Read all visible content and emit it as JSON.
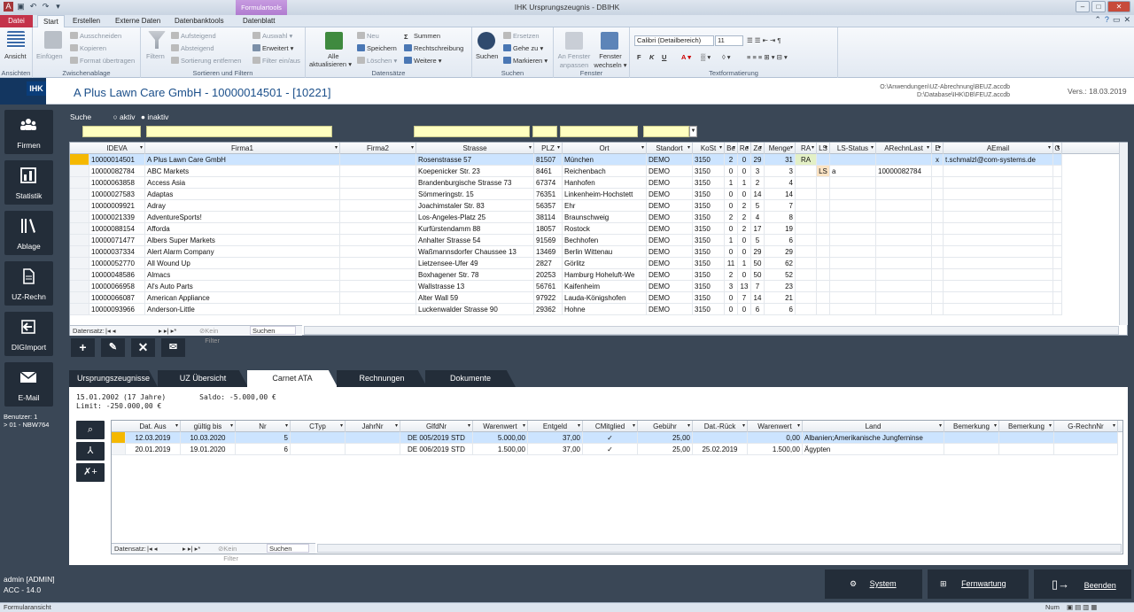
{
  "titlebar": {
    "title": "IHK Ursprungszeugnis - DBIHK",
    "context_tab_group": "Formulartools"
  },
  "ribbon_tabs": [
    {
      "label": "Datei"
    },
    {
      "label": "Start"
    },
    {
      "label": "Erstellen"
    },
    {
      "label": "Externe Daten"
    },
    {
      "label": "Datenbanktools"
    },
    {
      "label": "Datenblatt"
    }
  ],
  "ribbon": {
    "ansichten": {
      "label": "Ansichten",
      "ansicht": "Ansicht"
    },
    "zwischenablage": {
      "label": "Zwischenablage",
      "einfuegen": "Einfügen",
      "ausschneiden": "Ausschneiden",
      "kopieren": "Kopieren",
      "format": "Format übertragen"
    },
    "sortieren": {
      "label": "Sortieren und Filtern",
      "filter": "Filtern",
      "aufsteigend": "Aufsteigend",
      "absteigend": "Absteigend",
      "sortierung": "Sortierung entfernen",
      "auswahl": "Auswahl",
      "erweitert": "Erweitert",
      "filter_ein": "Filter ein/aus"
    },
    "datensaetze": {
      "label": "Datensätze",
      "alle": "Alle",
      "aktualisieren": "aktualisieren",
      "neu": "Neu",
      "speichern": "Speichern",
      "loeschen": "Löschen",
      "summen": "Summen",
      "rechtschreibung": "Rechtschreibung",
      "weitere": "Weitere"
    },
    "suchen": {
      "label": "Suchen",
      "suchen": "Suchen",
      "ersetzen": "Ersetzen",
      "gehe": "Gehe zu",
      "markieren": "Markieren"
    },
    "fenster": {
      "label": "Fenster",
      "anpassen1": "An Fenster",
      "anpassen2": "anpassen",
      "wechseln1": "Fenster",
      "wechseln2": "wechseln"
    },
    "text": {
      "label": "Textformatierung",
      "font": "Calibri (Detailbereich)",
      "size": "11"
    }
  },
  "header": {
    "record_title": "A Plus Lawn Care GmbH - 10000014501 - [10221]",
    "path1": "O:\\Anwendungen\\UZ-Abrechnung\\BEUZ.accdb",
    "path2": "D:\\Database\\IHK\\DB\\FEUZ.accdb",
    "version": "Vers.: 18.03.2019",
    "logo_text": "IHK"
  },
  "leftnav": [
    {
      "label": "Firmen",
      "icon": "people-icon"
    },
    {
      "label": "Statistik",
      "icon": "chart-icon"
    },
    {
      "label": "Ablage",
      "icon": "books-icon"
    },
    {
      "label": "UZ-Rechn",
      "icon": "document-icon"
    },
    {
      "label": "DIGImport",
      "icon": "import-icon"
    },
    {
      "label": "E-Mail",
      "icon": "mail-icon"
    }
  ],
  "benutzer": {
    "line1": "Benutzer: 1",
    "line2": "> 01 - NBW764"
  },
  "search": {
    "label": "Suche",
    "aktiv": "aktiv",
    "inaktiv": "inaktiv"
  },
  "companies": {
    "columns": [
      "IDEVA",
      "Firma1",
      "Firma2",
      "Strasse",
      "PLZ",
      "Ort",
      "Standort",
      "KoSt",
      "Be",
      "Re",
      "Ze",
      "Menge",
      "RA",
      "LS",
      "LS-Status",
      "ARechnLast",
      "E",
      "AEmail",
      "G"
    ],
    "rows": [
      [
        "10000014501",
        "A Plus Lawn Care GmbH",
        "",
        "Rosenstrasse 57",
        "81507",
        "München",
        "DEMO",
        "3150",
        "2",
        "0",
        "29",
        "31",
        "RA",
        "",
        "",
        "",
        "x",
        "t.schmalzl@com-systems.de",
        ""
      ],
      [
        "10000082784",
        "ABC Markets",
        "",
        "Koepenicker Str. 23",
        "8461",
        "Reichenbach",
        "DEMO",
        "3150",
        "0",
        "0",
        "3",
        "3",
        "",
        "LS",
        "a",
        "10000082784",
        "",
        "",
        ""
      ],
      [
        "10000063858",
        "Access Asia",
        "",
        "Brandenburgische Strasse 73",
        "67374",
        "Hanhofen",
        "DEMO",
        "3150",
        "1",
        "1",
        "2",
        "4",
        "",
        "",
        "",
        "",
        "",
        "",
        ""
      ],
      [
        "10000027583",
        "Adaptas",
        "",
        "Sömmeringstr. 15",
        "76351",
        "Linkenheim-Hochstett",
        "DEMO",
        "3150",
        "0",
        "0",
        "14",
        "14",
        "",
        "",
        "",
        "",
        "",
        "",
        ""
      ],
      [
        "10000009921",
        "Adray",
        "",
        "Joachimstaler Str. 83",
        "56357",
        "Ehr",
        "DEMO",
        "3150",
        "0",
        "2",
        "5",
        "7",
        "",
        "",
        "",
        "",
        "",
        "",
        ""
      ],
      [
        "10000021339",
        "AdventureSports!",
        "",
        "Los-Angeles-Platz 25",
        "38114",
        "Braunschweig",
        "DEMO",
        "3150",
        "2",
        "2",
        "4",
        "8",
        "",
        "",
        "",
        "",
        "",
        "",
        ""
      ],
      [
        "10000088154",
        "Afforda",
        "",
        "Kurfürstendamm 88",
        "18057",
        "Rostock",
        "DEMO",
        "3150",
        "0",
        "2",
        "17",
        "19",
        "",
        "",
        "",
        "",
        "",
        "",
        ""
      ],
      [
        "10000071477",
        "Albers Super Markets",
        "",
        "Anhalter Strasse 54",
        "91569",
        "Bechhofen",
        "DEMO",
        "3150",
        "1",
        "0",
        "5",
        "6",
        "",
        "",
        "",
        "",
        "",
        "",
        ""
      ],
      [
        "10000037334",
        "Alert Alarm Company",
        "",
        "Waßmannsdorfer Chaussee 13",
        "13469",
        "Berlin Wittenau",
        "DEMO",
        "3150",
        "0",
        "0",
        "29",
        "29",
        "",
        "",
        "",
        "",
        "",
        "",
        ""
      ],
      [
        "10000052770",
        "All Wound Up",
        "",
        "Lietzensee-Ufer 49",
        "2827",
        "Görlitz",
        "DEMO",
        "3150",
        "11",
        "1",
        "50",
        "62",
        "",
        "",
        "",
        "",
        "",
        "",
        ""
      ],
      [
        "10000048586",
        "Almacs",
        "",
        "Boxhagener Str. 78",
        "20253",
        "Hamburg Hoheluft-We",
        "DEMO",
        "3150",
        "2",
        "0",
        "50",
        "52",
        "",
        "",
        "",
        "",
        "",
        "",
        ""
      ],
      [
        "10000066958",
        "Al's Auto Parts",
        "",
        "Wallstrasse 13",
        "56761",
        "Kaifenheim",
        "DEMO",
        "3150",
        "3",
        "13",
        "7",
        "23",
        "",
        "",
        "",
        "",
        "",
        "",
        ""
      ],
      [
        "10000066087",
        "American Appliance",
        "",
        "Alter Wall 59",
        "97922",
        "Lauda-Königshofen",
        "DEMO",
        "3150",
        "0",
        "7",
        "14",
        "21",
        "",
        "",
        "",
        "",
        "",
        "",
        ""
      ],
      [
        "10000093966",
        "Anderson-Little",
        "",
        "Luckenwalder Strasse 90",
        "29362",
        "Hohne",
        "DEMO",
        "3150",
        "0",
        "0",
        "6",
        "6",
        "",
        "",
        "",
        "",
        "",
        "",
        ""
      ]
    ],
    "navbar": {
      "label": "Datensatz:",
      "kein_filter": "Kein Filter",
      "suchen": "Suchen"
    }
  },
  "tabs": [
    {
      "label": "Ursprungszeugnisse"
    },
    {
      "label": "UZ Übersicht"
    },
    {
      "label": "Carnet ATA"
    },
    {
      "label": "Rechnungen"
    },
    {
      "label": "Dokumente"
    }
  ],
  "carnet_info": {
    "line1": "15.01.2002 (17 Jahre)",
    "saldo": "Saldo: -5.000,00 €",
    "line2": "Limit: -250.000,00 €"
  },
  "carnet": {
    "columns": [
      "Dat. Aus",
      "gültig bis",
      "Nr",
      "CTyp",
      "JahrNr",
      "GlfdNr",
      "Warenwert",
      "Entgeld",
      "CMitglied",
      "Gebühr",
      "Dat.-Rück",
      "Warenwert",
      "Land",
      "Bemerkung",
      "Bemerkung",
      "G-RechnNr"
    ],
    "rows": [
      [
        "12.03.2019",
        "10.03.2020",
        "5",
        "",
        "",
        "DE 005/2019 STD",
        "5.000,00",
        "37,00",
        "✓",
        "25,00",
        "",
        "0,00",
        "Albanien;Amerikanische Jungferninse",
        "",
        "",
        ""
      ],
      [
        "20.01.2019",
        "19.01.2020",
        "6",
        "",
        "",
        "DE 006/2019 STD",
        "1.500,00",
        "37,00",
        "✓",
        "25,00",
        "25.02.2019",
        "1.500,00",
        "Ägypten",
        "",
        "",
        ""
      ]
    ],
    "navbar": {
      "label": "Datensatz:",
      "kein_filter": "Kein Filter",
      "suchen": "Suchen"
    }
  },
  "bottom": {
    "admin": "admin [ADMIN]",
    "acc": "ACC - 14.0",
    "system": "System",
    "fernwartung": "Fernwartung",
    "beenden": "Beenden"
  },
  "statusbar": {
    "left": "Formularansicht",
    "num": "Num"
  }
}
